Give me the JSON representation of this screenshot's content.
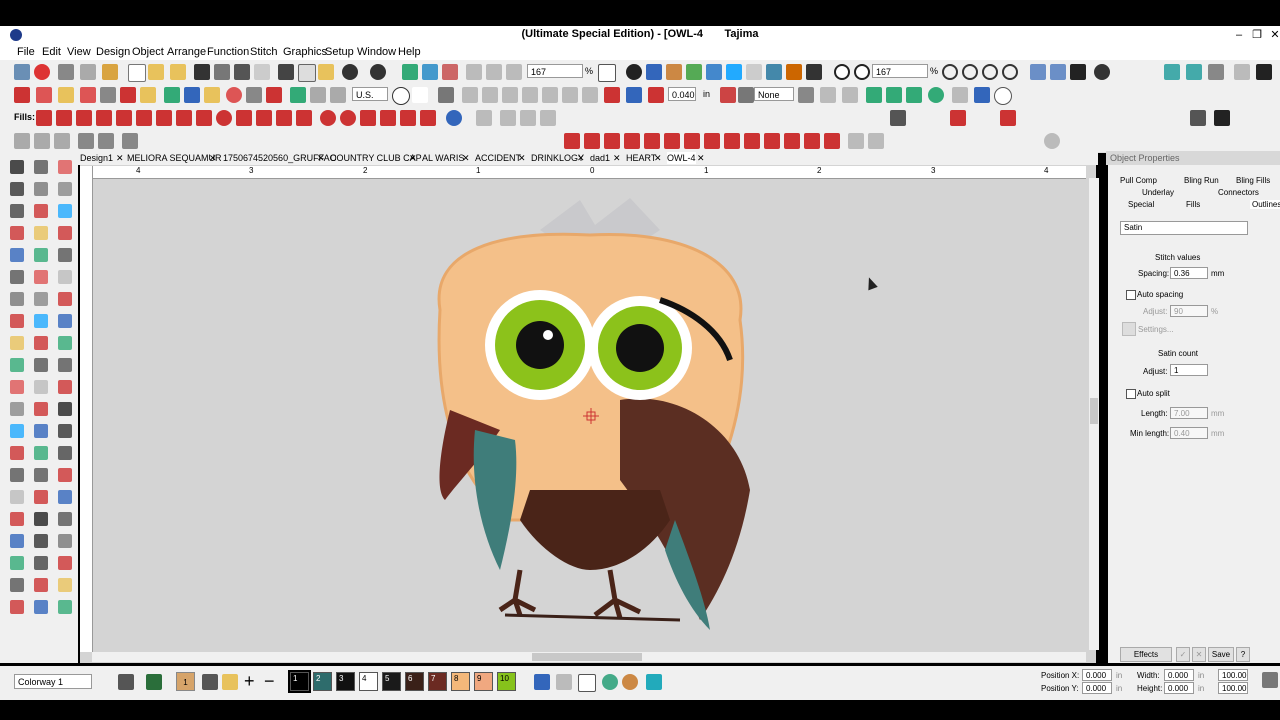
{
  "window": {
    "title": "(Ultimate Special Edition) - [OWL-4",
    "app": "Tajima"
  },
  "menu": [
    "File",
    "Edit",
    "View",
    "Design",
    "Object",
    "Arrange",
    "Function",
    "Stitch",
    "Graphics",
    "Setup",
    "Window",
    "Help"
  ],
  "toolbar": {
    "zoom_value_1": "167",
    "zoom_value_2": "167",
    "percent": "%",
    "units": "U.S.",
    "density": "0.040",
    "density_unit": "in",
    "none_select": "None",
    "fills_label": "Fills:"
  },
  "doc_tabs": [
    "Design1",
    "MELIORA SEQUAMUR",
    "1750674520560_GRUFFAO",
    "COUNTRY CLUB CAP",
    "AL WARIS",
    "ACCIDENT",
    "DRINKLOGY",
    "dad1",
    "HEART",
    "OWL-4"
  ],
  "ruler": {
    "h_ticks": [
      "4",
      "3",
      "2",
      "1",
      "0",
      "1",
      "2",
      "3",
      "4"
    ]
  },
  "object_properties": {
    "title": "Object Properties",
    "tabs_row1": [
      "Pull Comp",
      "Bling Run",
      "Bling Fills"
    ],
    "tabs_row2": [
      "Underlay",
      "Connectors"
    ],
    "tabs_row3": [
      "Special",
      "Fills",
      "Outlines"
    ],
    "type": "Satin",
    "stitch_values_label": "Stitch values",
    "spacing_label": "Spacing:",
    "spacing_value": "0.36",
    "spacing_unit": "mm",
    "auto_spacing_label": "Auto spacing",
    "adjust_label": "Adjust:",
    "adjust_value": "90",
    "adjust_unit": "%",
    "settings_label": "Settings...",
    "satin_count_label": "Satin count",
    "satin_adjust_label": "Adjust:",
    "satin_adjust_value": "1",
    "auto_split_label": "Auto split",
    "length_label": "Length:",
    "length_value": "7.00",
    "length_unit": "mm",
    "min_length_label": "Min length:",
    "min_length_value": "0.40",
    "min_length_unit": "mm",
    "effects_button": "Effects",
    "save_button": "Save",
    "help_button": "?"
  },
  "status": {
    "colorway": "Colorway 1",
    "swatches": [
      {
        "n": "1",
        "color": "#000000"
      },
      {
        "n": "2",
        "color": "#2e6c6c"
      },
      {
        "n": "3",
        "color": "#111111"
      },
      {
        "n": "4",
        "color": "#ffffff"
      },
      {
        "n": "5",
        "color": "#1a1a1a"
      },
      {
        "n": "6",
        "color": "#3a2018"
      },
      {
        "n": "7",
        "color": "#6b2a22"
      },
      {
        "n": "8",
        "color": "#f4b87a"
      },
      {
        "n": "9",
        "color": "#f0a880"
      },
      {
        "n": "10",
        "color": "#86c21b"
      }
    ],
    "selected_swatch_label": "1",
    "position_x_label": "Position X:",
    "position_x_value": "0.000",
    "position_y_label": "Position Y:",
    "position_y_value": "0.000",
    "width_label": "Width:",
    "width_value": "0.000",
    "height_label": "Height:",
    "height_value": "0.000",
    "unit": "in",
    "pct_w": "100.00",
    "pct_h": "100.00"
  },
  "colors": {
    "accent": "#cc2222",
    "panel": "#f0f0f0",
    "canvas": "#d4d4d4",
    "owl_body": "#f4c089",
    "owl_eye": "#8cc21b"
  }
}
